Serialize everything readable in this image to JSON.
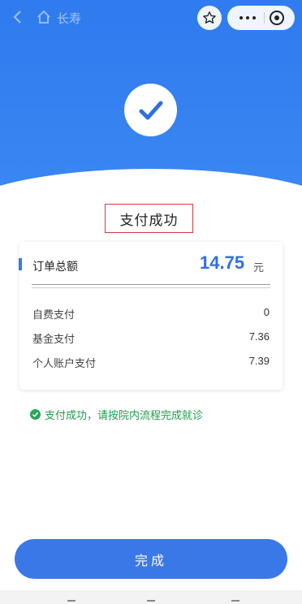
{
  "topbar": {
    "title": "长寿",
    "icons": [
      "back-arrow-icon",
      "home-icon",
      "star-icon",
      "more-icon",
      "close-target-icon"
    ]
  },
  "status": {
    "title": "支付成功",
    "icon": "check-icon"
  },
  "order": {
    "total_label": "订单总额",
    "total_amount": "14.75",
    "total_unit": "元",
    "rows": [
      {
        "label": "自费支付",
        "value": "0"
      },
      {
        "label": "基金支付",
        "value": "7.36"
      },
      {
        "label": "个人账户支付",
        "value": "7.39"
      }
    ]
  },
  "notice": {
    "text": "支付成功，请按院内流程完成就诊",
    "icon": "check-circle-icon"
  },
  "done_button": {
    "label": "完成"
  },
  "colors": {
    "primary": "#2f7bef",
    "amount": "#2f6fe0",
    "success": "#1f9c4f",
    "highlight_border": "#d63a3a"
  }
}
